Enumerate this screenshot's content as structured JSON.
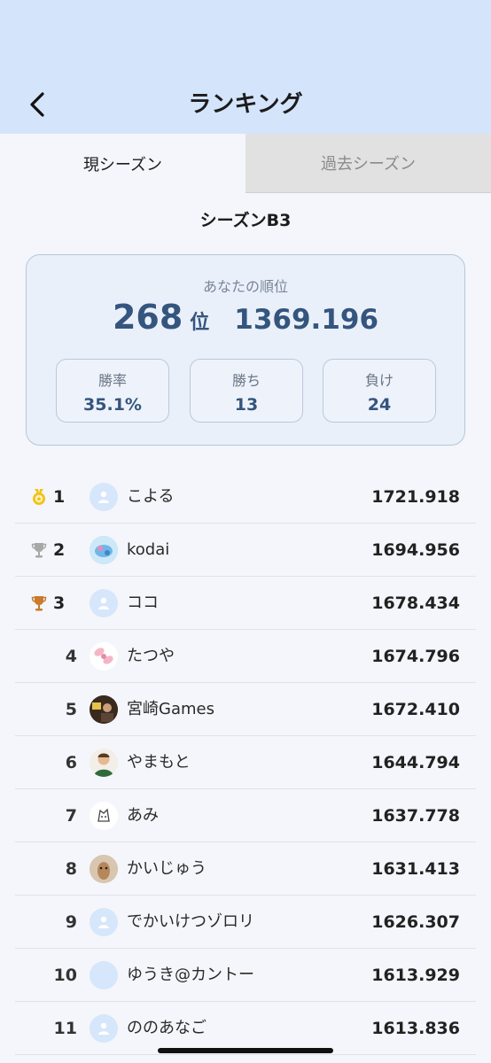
{
  "header": {
    "title": "ランキング",
    "back_icon": "chevron-left-icon",
    "background": "#d4e4fb"
  },
  "tabs": [
    {
      "label": "現シーズン",
      "active": true
    },
    {
      "label": "過去シーズン",
      "active": false
    }
  ],
  "season": {
    "title": "シーズンB3"
  },
  "my_ranking": {
    "label": "あなたの順位",
    "rank": "268",
    "rank_unit": "位",
    "score": "1369.196",
    "stats": [
      {
        "label": "勝率",
        "value": "35.1%"
      },
      {
        "label": "勝ち",
        "value": "13"
      },
      {
        "label": "負け",
        "value": "24"
      }
    ]
  },
  "ranking": [
    {
      "rank": "1",
      "name": "こよる",
      "score": "1721.918",
      "icon": "gold-medal-icon",
      "avatar": "default-user-icon"
    },
    {
      "rank": "2",
      "name": "kodai",
      "score": "1694.956",
      "icon": "silver-trophy-icon",
      "avatar": "photo-avatar"
    },
    {
      "rank": "3",
      "name": "ココ",
      "score": "1678.434",
      "icon": "bronze-trophy-icon",
      "avatar": "default-user-icon"
    },
    {
      "rank": "4",
      "name": "たつや",
      "score": "1674.796",
      "avatar": "photo-avatar"
    },
    {
      "rank": "5",
      "name": "宮崎Games",
      "score": "1672.410",
      "avatar": "photo-avatar"
    },
    {
      "rank": "6",
      "name": "やまもと",
      "score": "1644.794",
      "avatar": "photo-avatar"
    },
    {
      "rank": "7",
      "name": "あみ",
      "score": "1637.778",
      "avatar": "photo-avatar"
    },
    {
      "rank": "8",
      "name": "かいじゅう",
      "score": "1631.413",
      "avatar": "photo-avatar"
    },
    {
      "rank": "9",
      "name": "でかいけつゾロリ",
      "score": "1626.307",
      "avatar": "default-user-icon"
    },
    {
      "rank": "10",
      "name": "ゆうき@カントー",
      "score": "1613.929",
      "avatar": "blank-avatar"
    },
    {
      "rank": "11",
      "name": "ののあなご",
      "score": "1613.836",
      "avatar": "default-user-icon"
    }
  ],
  "colors": {
    "accent": "#34557e",
    "gold": "#f2c21a",
    "silver": "#a8a8a8",
    "bronze": "#c97a2b"
  }
}
